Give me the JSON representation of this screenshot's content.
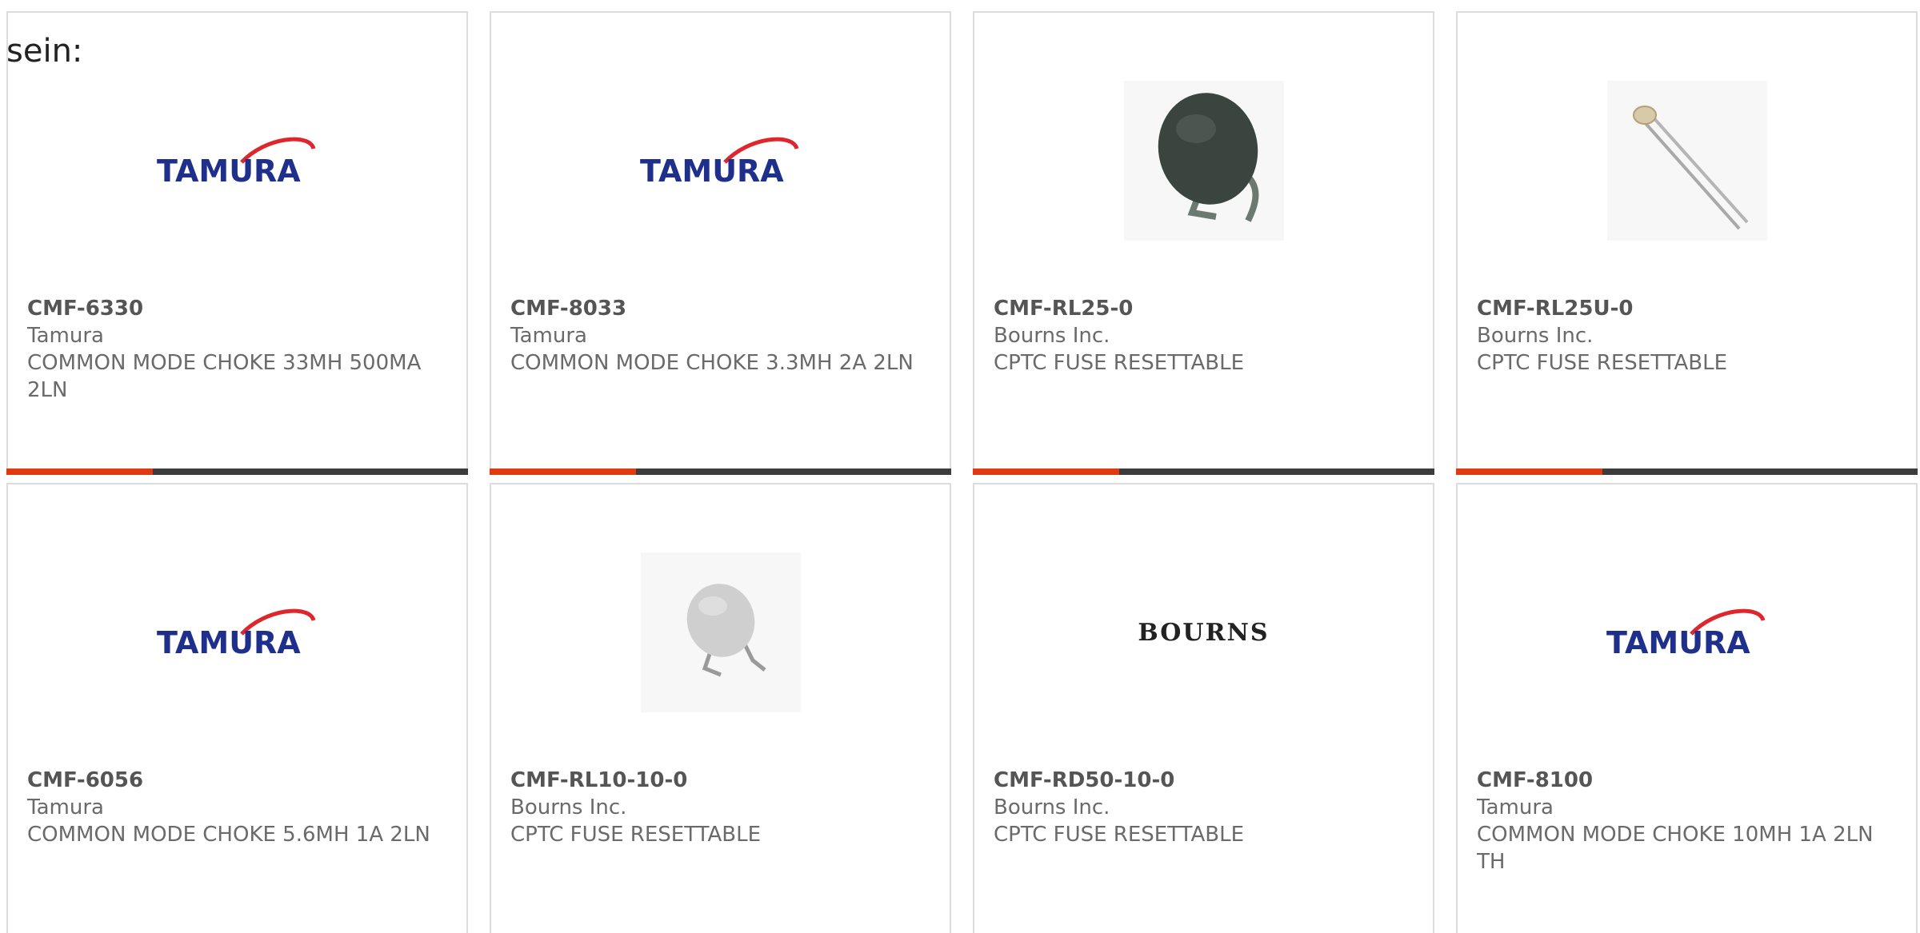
{
  "intro_text": "sein:",
  "products": [
    {
      "part": "CMF-6330",
      "maker": "Tamura",
      "desc": "COMMON MODE CHOKE 33MH 500MA 2LN",
      "image": "tamura-logo"
    },
    {
      "part": "CMF-8033",
      "maker": "Tamura",
      "desc": "COMMON MODE CHOKE 3.3MH 2A 2LN",
      "image": "tamura-logo"
    },
    {
      "part": "CMF-RL25-0",
      "maker": "Bourns Inc.",
      "desc": "CPTC FUSE RESETTABLE",
      "image": "dark-ptc-fuse-photo"
    },
    {
      "part": "CMF-RL25U-0",
      "maker": "Bourns Inc.",
      "desc": "CPTC FUSE RESETTABLE",
      "image": "small-thermistor-photo"
    },
    {
      "part": "CMF-6056",
      "maker": "Tamura",
      "desc": "COMMON MODE CHOKE 5.6MH 1A 2LN",
      "image": "tamura-logo"
    },
    {
      "part": "CMF-RL10-10-0",
      "maker": "Bourns Inc.",
      "desc": "CPTC FUSE RESETTABLE",
      "image": "grey-ptc-fuse-photo"
    },
    {
      "part": "CMF-RD50-10-0",
      "maker": "Bourns Inc.",
      "desc": "CPTC FUSE RESETTABLE",
      "image": "bourns-logo"
    },
    {
      "part": "CMF-8100",
      "maker": "Tamura",
      "desc": "COMMON MODE CHOKE 10MH 1A 2LN TH",
      "image": "tamura-logo"
    }
  ],
  "logos": {
    "tamura": "TAMURA",
    "bourns": "BOURNS"
  },
  "colors": {
    "accent": "#e03a10",
    "bar": "#3c3c3c",
    "tamura_blue": "#1e2f8c",
    "tamura_red": "#e0262d"
  }
}
